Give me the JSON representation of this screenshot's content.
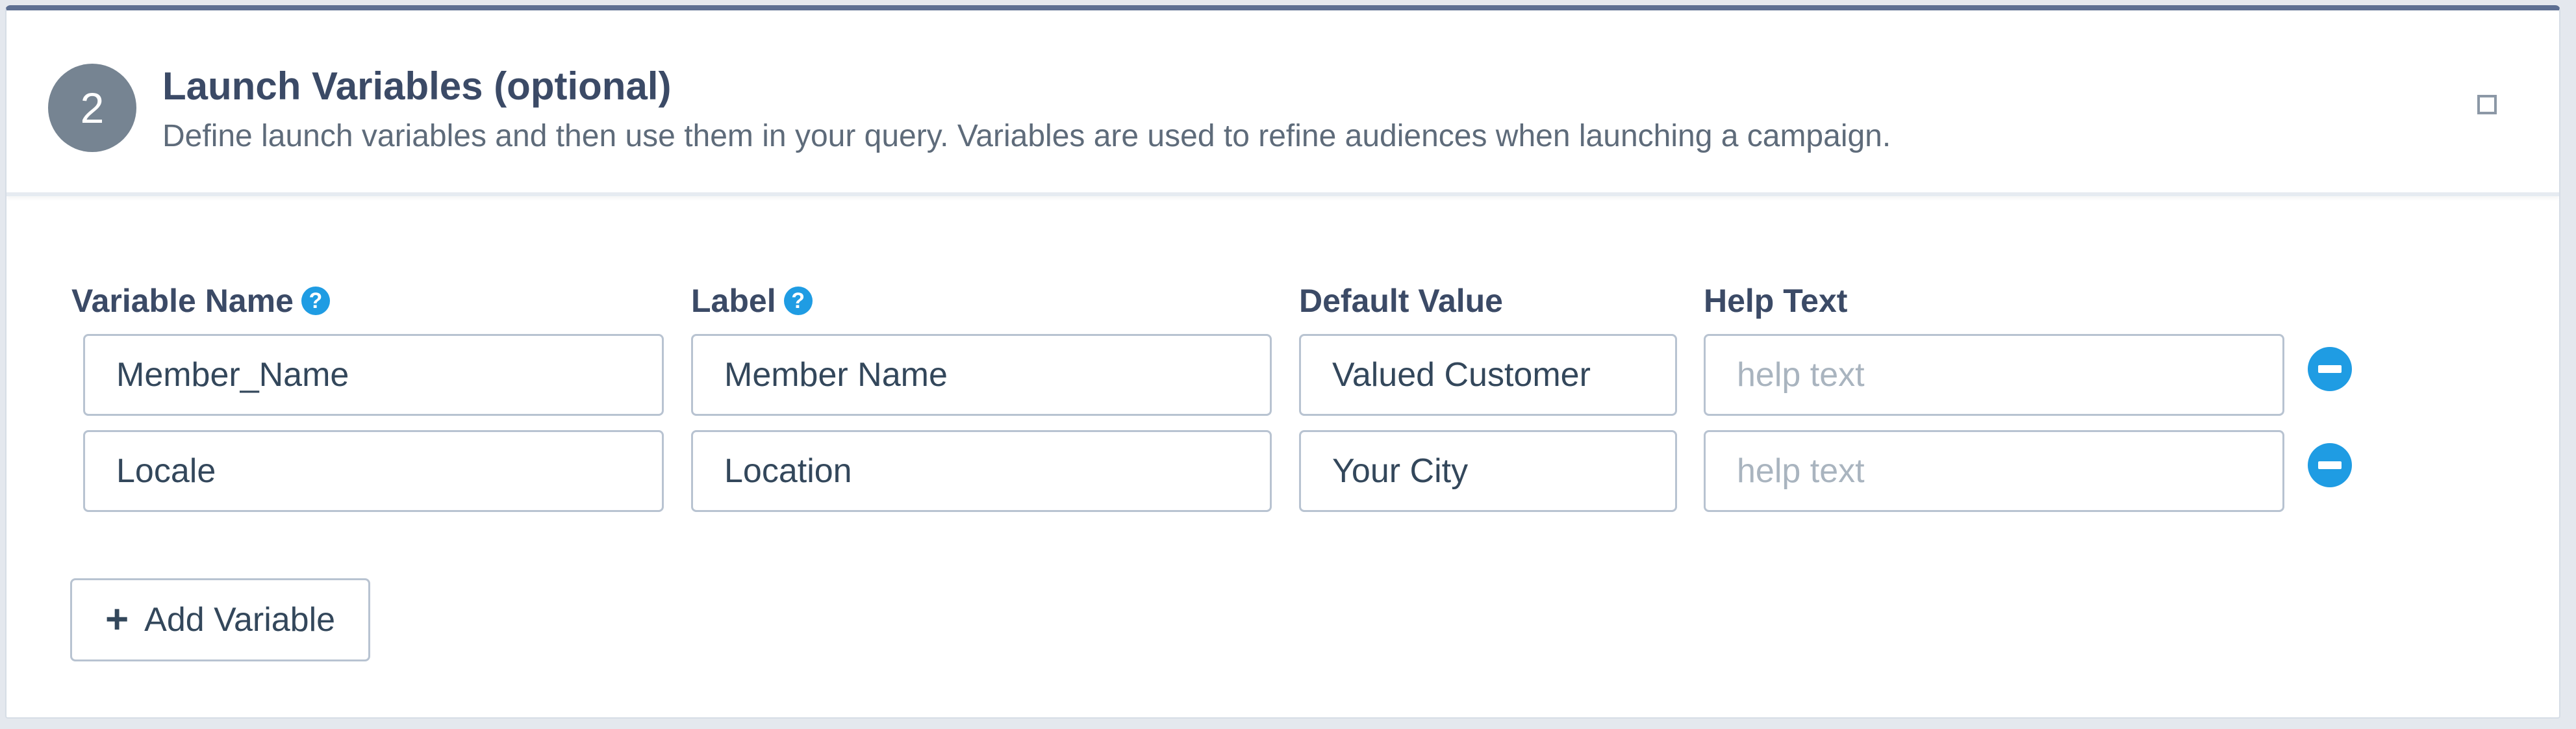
{
  "section": {
    "step_number": "2",
    "title": "Launch Variables (optional)",
    "description": "Define launch variables and then use them in your query. Variables are used to refine audiences when launching a campaign."
  },
  "columns": {
    "variable_name": "Variable Name",
    "label": "Label",
    "default_value": "Default Value",
    "help_text": "Help Text"
  },
  "rows": [
    {
      "variable_name": "Member_Name",
      "label": "Member Name",
      "default_value": "Valued Customer",
      "help_text": "",
      "help_text_placeholder": "help text"
    },
    {
      "variable_name": "Locale",
      "label": "Location",
      "default_value": "Your City",
      "help_text": "",
      "help_text_placeholder": "help text"
    }
  ],
  "actions": {
    "add_variable_label": "Add Variable"
  },
  "icons": {
    "help": "?",
    "add": "+"
  },
  "colors": {
    "accent": "#1f9ce3",
    "header_top_border": "#5d6f92",
    "badge": "#768492"
  }
}
